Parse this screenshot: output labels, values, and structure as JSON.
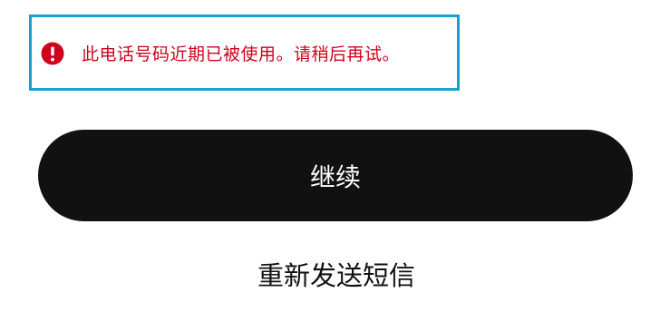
{
  "error": {
    "message": "此电话号码近期已被使用。请稍后再试。",
    "icon": "error-exclamation-icon",
    "color": "#d0021b",
    "border_color": "#1a9fd0"
  },
  "actions": {
    "continue_label": "继续",
    "resend_label": "重新发送短信"
  }
}
